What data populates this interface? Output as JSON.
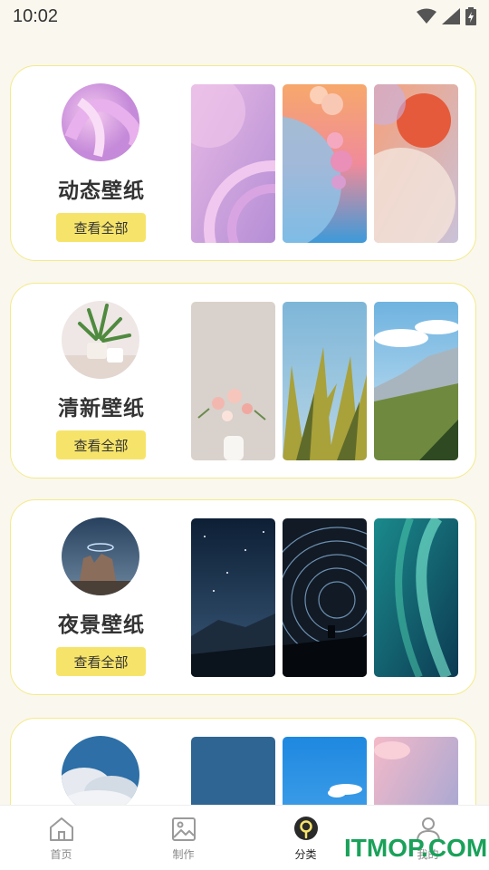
{
  "status_bar": {
    "time": "10:02"
  },
  "categories": [
    {
      "title": "动态壁纸",
      "button": "查看全部"
    },
    {
      "title": "清新壁纸",
      "button": "查看全部"
    },
    {
      "title": "夜景壁纸",
      "button": "查看全部"
    },
    {
      "title": "",
      "button": ""
    }
  ],
  "tabs": [
    {
      "label": "首页",
      "icon": "home-icon"
    },
    {
      "label": "制作",
      "icon": "image-icon"
    },
    {
      "label": "分类",
      "icon": "category-icon",
      "active": true
    },
    {
      "label": "我的",
      "icon": "user-icon"
    }
  ],
  "watermark": "ITMOP.COM",
  "colors": {
    "accent_yellow": "#f6e46a",
    "card_border": "#f3ea8a",
    "background": "#faf7ee"
  }
}
